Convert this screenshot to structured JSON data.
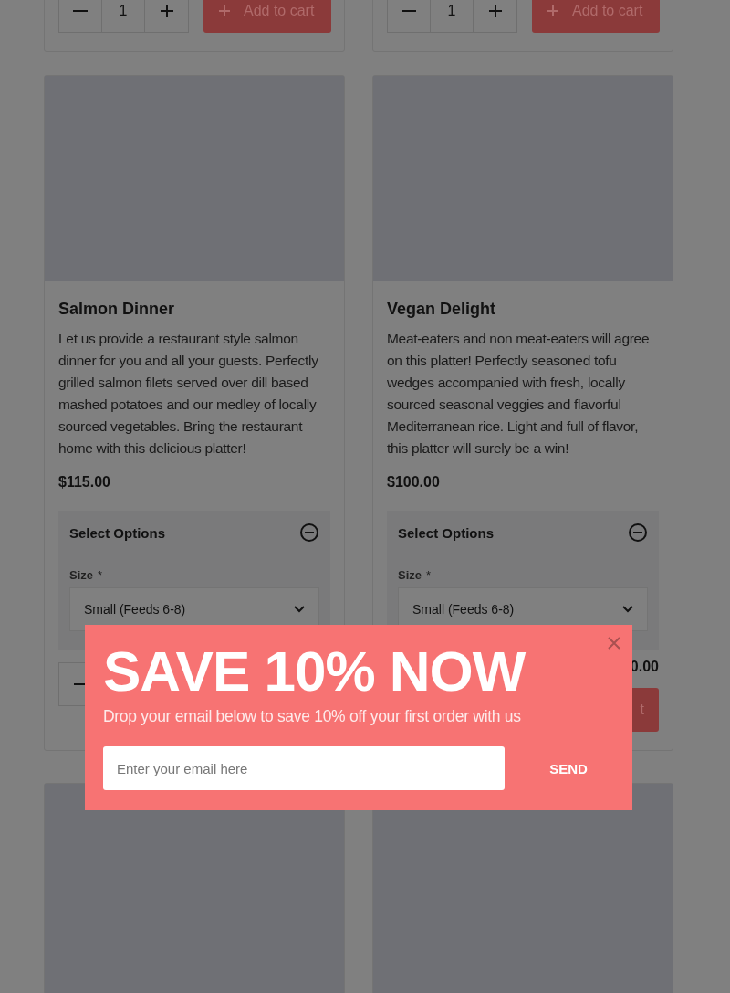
{
  "top_row": [
    {
      "quantity": "1",
      "add_to_cart": "Add to cart"
    },
    {
      "quantity": "1",
      "add_to_cart": "Add to cart"
    }
  ],
  "products": [
    {
      "name": "Salmon Dinner",
      "description": "Let us provide a restaurant style salmon dinner for you and all your guests. Perfectly grilled salmon filets served over dill based mashed potatoes and our medley of locally sourced vegetables. Bring the restaurant home with this delicious platter!",
      "price": "$115.00",
      "options_title": "Select Options",
      "size_label": "Size",
      "required_mark": "*",
      "size_value": "Small (Feeds 6-8)",
      "expanded": true
    },
    {
      "name": "Vegan Delight",
      "description": "Meat-eaters and non meat-eaters will agree on this platter! Perfectly seasoned tofu wedges accompanied with fresh, locally sourced seasonal veggies and flavorful Mediterranean rice. Light and full of flavor, this platter will surely be a win!",
      "price": "$100.00",
      "options_title": "Select Options",
      "size_label": "Size",
      "required_mark": "*",
      "size_value": "Small (Feeds 6-8)",
      "expanded": true,
      "total_visible": "0.00",
      "add_to_cart_visible": "t"
    }
  ],
  "more_products": [
    {
      "kind": "placeholder"
    },
    {
      "kind": "placeholder"
    }
  ],
  "popup": {
    "title": "SAVE 10% NOW",
    "subtitle": "Drop your email below to save 10% off your first order with us",
    "email": {
      "placeholder": "Enter your email here"
    },
    "send": "SEND"
  }
}
